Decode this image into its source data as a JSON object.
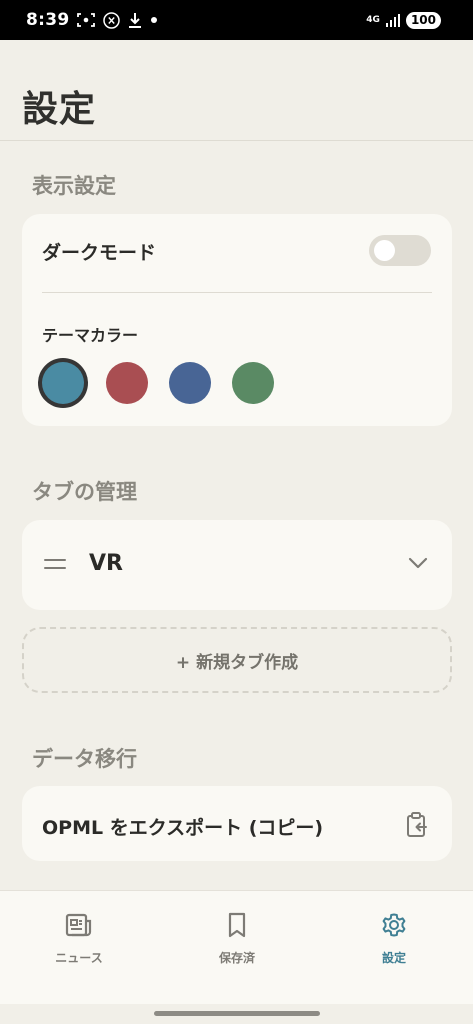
{
  "status_bar": {
    "time": "8:39",
    "network": "4G",
    "battery": "100"
  },
  "header": {
    "title": "設定"
  },
  "display_section": {
    "title": "表示設定",
    "dark_mode_label": "ダークモード",
    "dark_mode_on": false,
    "theme_color_label": "テーマカラー",
    "colors": [
      "#4a8ba3",
      "#a94e52",
      "#486595",
      "#5a8a64"
    ],
    "selected_color": "#4a8ba3"
  },
  "tabs_section": {
    "title": "タブの管理",
    "tabs": [
      {
        "name": "VR"
      }
    ],
    "new_tab_label": "+ 新規タブ作成"
  },
  "data_section": {
    "title": "データ移行",
    "export_label": "OPML をエクスポート (コピー)"
  },
  "bottom_nav": {
    "items": [
      {
        "label": "ニュース",
        "icon": "newspaper-icon",
        "active": false
      },
      {
        "label": "保存済",
        "icon": "bookmark-icon",
        "active": false
      },
      {
        "label": "設定",
        "icon": "gear-icon",
        "active": true
      }
    ],
    "active_color": "#3f7f93"
  }
}
